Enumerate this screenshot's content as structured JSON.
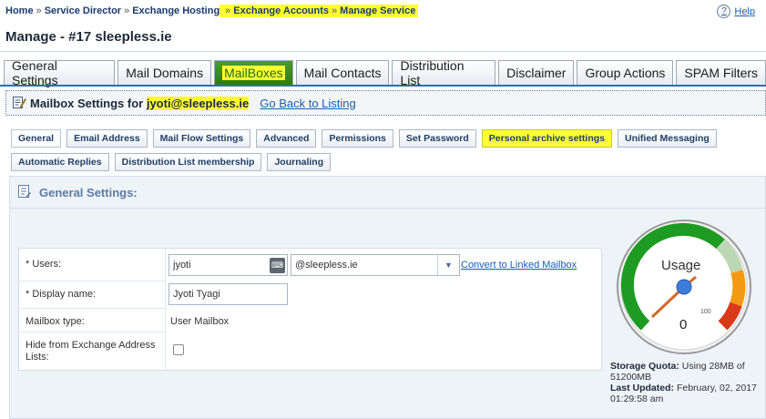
{
  "breadcrumb": {
    "items": [
      "Home",
      "Service Director",
      "Exchange Hosting",
      "Exchange Accounts",
      "Manage Service"
    ],
    "separator": "»"
  },
  "help": {
    "label": "Help",
    "icon": "?"
  },
  "page_title": "Manage - #17 sleepless.ie",
  "tabs": [
    {
      "label": "General Settings"
    },
    {
      "label": "Mail Domains"
    },
    {
      "label": "MailBoxes"
    },
    {
      "label": "Mail Contacts"
    },
    {
      "label": "Distribution List"
    },
    {
      "label": "Disclaimer"
    },
    {
      "label": "Group Actions"
    },
    {
      "label": "SPAM Filters"
    }
  ],
  "mailbox_header": {
    "prefix": "Mailbox Settings for ",
    "email": "jyoti@sleepless.ie",
    "back_link": "Go Back to Listing"
  },
  "subtabs": [
    {
      "label": "General"
    },
    {
      "label": "Email Address"
    },
    {
      "label": "Mail Flow Settings"
    },
    {
      "label": "Advanced"
    },
    {
      "label": "Permissions"
    },
    {
      "label": "Set Password"
    },
    {
      "label": "Personal archive settings"
    },
    {
      "label": "Unified Messaging"
    },
    {
      "label": "Automatic Replies"
    },
    {
      "label": "Distribution List membership"
    },
    {
      "label": "Journaling"
    }
  ],
  "panel": {
    "title": "General Settings:"
  },
  "form": {
    "users_label": "* Users:",
    "users_value": "jyoti",
    "domain_value": "@sleepless.ie",
    "convert_link": "Convert to Linked Mailbox",
    "display_name_label": "* Display name:",
    "display_name_value": "Jyoti Tyagi",
    "mailbox_type_label": "Mailbox type:",
    "mailbox_type_value": "User Mailbox",
    "hide_label": "Hide from Exchange Address Lists:",
    "hide_checked": false
  },
  "gauge": {
    "title": "Usage",
    "value": "0",
    "max_label": "100",
    "colors": {
      "green": "#1e9b22",
      "orange": "#f39a12",
      "red": "#d83a1a",
      "needle": "#d26a2a",
      "hub": "#3c7ddb"
    }
  },
  "storage": {
    "quota_label": "Storage Quota:",
    "quota_value": "Using 28MB of 51200MB",
    "updated_label": "Last Updated:",
    "updated_value": "February, 02, 2017 01:29:58 am"
  },
  "highlight_color": "#ffff33",
  "accent_color": "#2e6fb0"
}
